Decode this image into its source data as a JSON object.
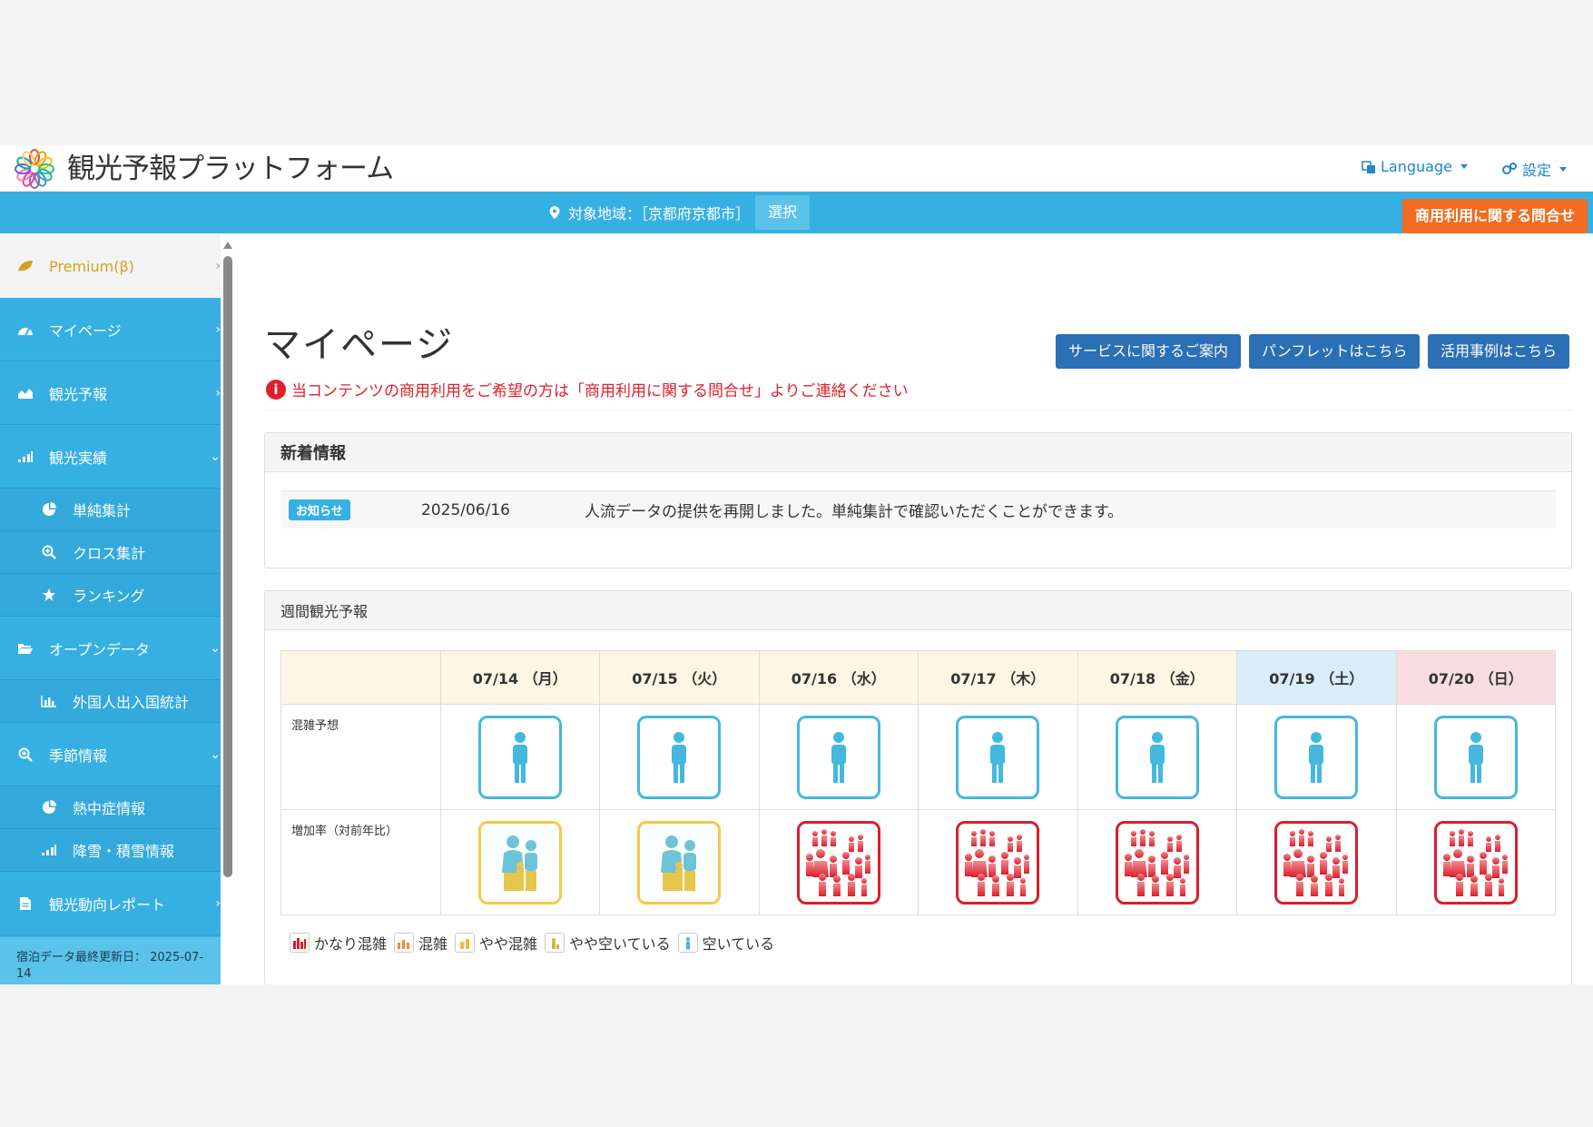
{
  "header": {
    "brand": "観光予報プラットフォーム",
    "language_label": "Language",
    "settings_label": "設定"
  },
  "region_bar": {
    "label": "対象地域：［京都府京都市］",
    "select_label": "選択",
    "business_inquiry_label": "商用利用に関する問合せ"
  },
  "sidebar": {
    "premium": "Premium(β)",
    "items": [
      {
        "label": "マイページ",
        "icon": "dashboard-icon"
      },
      {
        "label": "観光予報",
        "icon": "area-chart-icon"
      },
      {
        "label": "観光実績",
        "icon": "signal-bars-icon"
      },
      {
        "label": "単純集計",
        "icon": "pie-chart-icon"
      },
      {
        "label": "クロス集計",
        "icon": "zoom-in-icon"
      },
      {
        "label": "ランキング",
        "icon": "star-icon"
      },
      {
        "label": "オープンデータ",
        "icon": "folder-open-icon"
      },
      {
        "label": "外国人出入国統計",
        "icon": "bar-chart-icon"
      },
      {
        "label": "季節情報",
        "icon": "zoom-in-icon"
      },
      {
        "label": "熱中症情報",
        "icon": "pie-chart-icon"
      },
      {
        "label": "降雪・積雪情報",
        "icon": "signal-bars-icon"
      },
      {
        "label": "観光動向レポート",
        "icon": "file-icon"
      }
    ],
    "footer": "宿泊データ最終更新日： 2025-07-14"
  },
  "main": {
    "title": "マイページ",
    "buttons": {
      "service_info": "サービスに関するご案内",
      "pamphlet": "パンフレットはこちら",
      "case_studies": "活用事例はこちら"
    },
    "notice": "当コンテンツの商用利用をご希望の方は「商用利用に関する問合せ」よりご連絡ください"
  },
  "news": {
    "title": "新着情報",
    "badge": "お知らせ",
    "date": "2025/06/16",
    "text": "人流データの提供を再開しました。単純集計で確認いただくことができます。"
  },
  "weekly": {
    "title": "週間観光予報",
    "days": [
      "07/14 （月）",
      "07/15 （火）",
      "07/16 （水）",
      "07/17 （木）",
      "07/18 （金）",
      "07/19 （土）",
      "07/20 （日）"
    ],
    "rows": [
      {
        "label": "混雑予想",
        "levels": [
          "空いている",
          "空いている",
          "空いている",
          "空いている",
          "空いている",
          "空いている",
          "空いている"
        ]
      },
      {
        "label": "増加率（対前年比）",
        "levels": [
          "やや空いている",
          "やや空いている",
          "かなり混雑",
          "かなり混雑",
          "かなり混雑",
          "かなり混雑",
          "かなり混雑"
        ]
      }
    ],
    "legend": [
      "かなり混雑",
      "混雑",
      "やや混雑",
      "やや空いている",
      "空いている"
    ]
  },
  "colors": {
    "primary": "#36b0e3",
    "accent": "#f26c22",
    "button": "#2b6fb4",
    "warning": "#e0202c",
    "crowded": "#d91f2c",
    "empty": "#45b8dd",
    "slightly_empty": "#f5c94a"
  }
}
